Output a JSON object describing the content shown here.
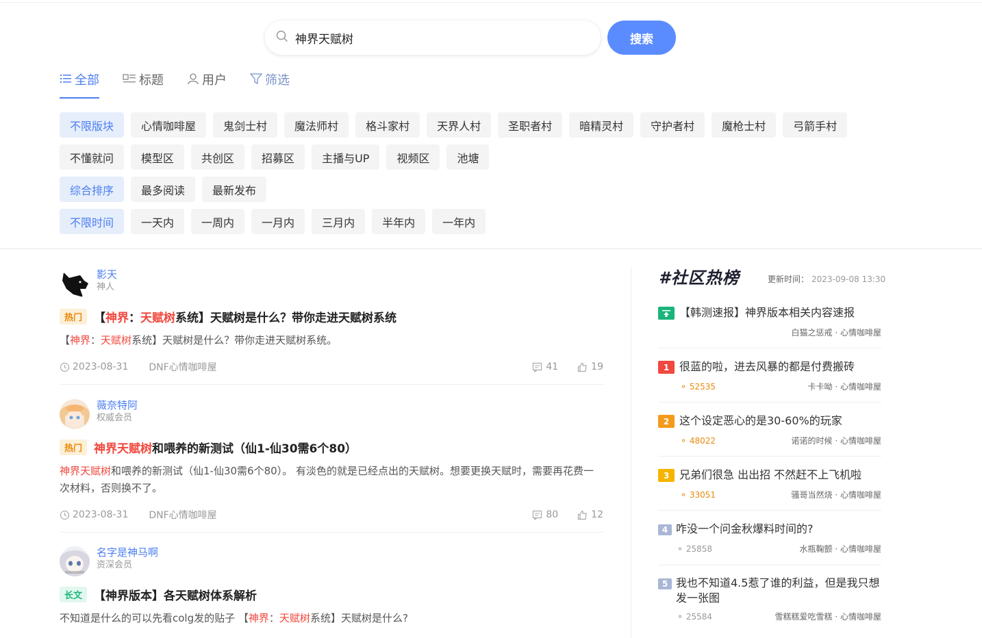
{
  "search": {
    "query": "神界天赋树",
    "button": "搜索"
  },
  "tabs": [
    {
      "label": "全部",
      "icon": "list-icon"
    },
    {
      "label": "标题",
      "icon": "title-icon"
    },
    {
      "label": "用户",
      "icon": "user-icon"
    },
    {
      "label": "筛选",
      "icon": "filter-icon"
    }
  ],
  "forums": [
    "不限版块",
    "心情咖啡屋",
    "鬼剑士村",
    "魔法师村",
    "格斗家村",
    "天界人村",
    "圣职者村",
    "暗精灵村",
    "守护者村",
    "魔枪士村",
    "弓箭手村"
  ],
  "forums2": [
    "不懂就问",
    "模型区",
    "共创区",
    "招募区",
    "主播与UP",
    "视频区",
    "池塘"
  ],
  "sorts": [
    "综合排序",
    "最多阅读",
    "最新发布"
  ],
  "times": [
    "不限时间",
    "一天内",
    "一周内",
    "一月内",
    "三月内",
    "半年内",
    "一年内"
  ],
  "posts": [
    {
      "author": "影天",
      "role": "神人",
      "badge": "热门",
      "title_pre": "【",
      "title_h1": "神界",
      "title_mid": "：",
      "title_h2": "天赋树",
      "title_post": "系统】天赋树是什么？带你走进天赋树系统",
      "sum_pre": "【",
      "sum_h1": "神界",
      "sum_mid": "：",
      "sum_h2": "天赋树",
      "sum_post": "系统】天赋树是什么？带你走进天赋树系统。",
      "date": "2023-08-31",
      "forum": "DNF心情咖啡屋",
      "comments": "41",
      "likes": "19"
    },
    {
      "author": "薇奈特阿",
      "role": "权威会员",
      "badge": "热门",
      "title_h": "神界天赋树",
      "title_post": "和喂养的新测试（仙1-仙30需6个80）",
      "sum_h": "神界天赋树",
      "sum_post": "和喂养的新测试（仙1-仙30需6个80）。 有淡色的就是已经点出的天赋树。想要更换天赋时，需要再花费一次材料，否则换不了。",
      "date": "2023-08-31",
      "forum": "DNF心情咖啡屋",
      "comments": "80",
      "likes": "12"
    },
    {
      "author": "名字是神马啊",
      "role": "资深会员",
      "badge": "长文",
      "title": "【神界版本】各天赋树体系解析",
      "sum_pre": "不知道是什么的可以先看colg发的贴子 【",
      "sum_h1": "神界",
      "sum_mid": "：",
      "sum_h2": "天赋树",
      "sum_post": "系统】天赋树是什么?"
    }
  ],
  "hot": {
    "title": "#社区热榜",
    "update_label": "更新时间：",
    "update_time": "2023-09-08 13:30",
    "items": [
      {
        "title": "【韩测速报】神界版本相关内容速报",
        "count": "",
        "source": "白猫之惩戒 · 心情咖啡屋",
        "rank": ""
      },
      {
        "title": "很蓝的啦，进去风暴的都是付费搬砖",
        "count": "52535",
        "source": "卡卡呦 · 心情咖啡屋",
        "rank": "1"
      },
      {
        "title": "这个设定恶心的是30-60%的玩家",
        "count": "48022",
        "source": "诺诺的时候 · 心情咖啡屋",
        "rank": "2"
      },
      {
        "title": "兄弟们很急 出出招 不然赶不上飞机啦",
        "count": "33051",
        "source": "骚哥当然烧 · 心情咖啡屋",
        "rank": "3"
      },
      {
        "title": "咋没一个问金秋爆料时间的?",
        "count": "25858",
        "source": "水瓶鞠颤 · 心情咖啡屋",
        "rank": "4"
      },
      {
        "title": "我也不知道4.5惹了谁的利益，但是我只想发一张图",
        "count": "25584",
        "source": "雪糕糕爱吃雪糕 · 心情咖啡屋",
        "rank": "5"
      }
    ]
  },
  "colors": {
    "accent": "#4c7ff0",
    "button": "#5b8cff",
    "highlight": "#f0483e",
    "rank1": "#f0483e",
    "rank2": "#f59a1b",
    "rank3": "#f5b400",
    "rank_other": "#a9b6d6"
  }
}
